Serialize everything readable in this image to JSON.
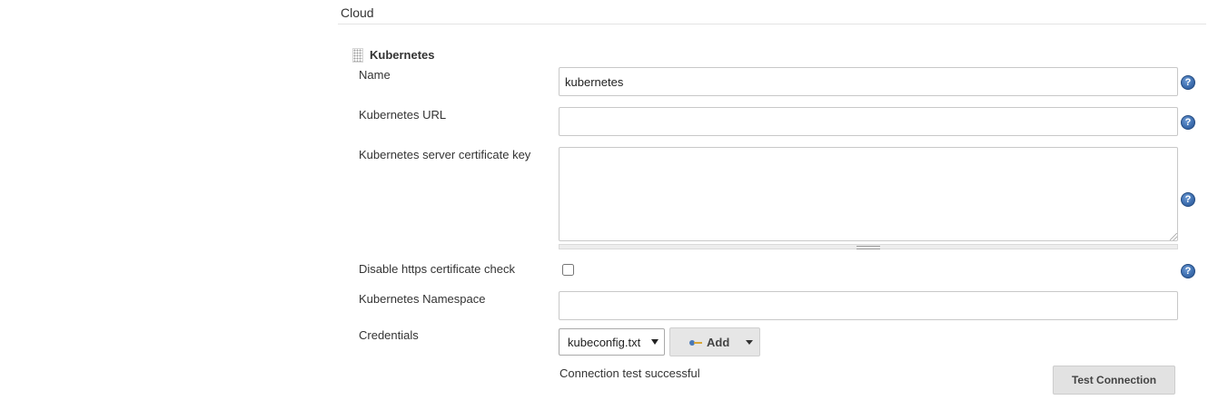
{
  "section": {
    "title": "Cloud"
  },
  "cloud": {
    "name": "Kubernetes"
  },
  "fields": {
    "name": {
      "label": "Name",
      "value": "kubernetes"
    },
    "url": {
      "label": "Kubernetes URL",
      "value": ""
    },
    "cert_key": {
      "label": "Kubernetes server certificate key",
      "value": ""
    },
    "disable_https": {
      "label": "Disable https certificate check",
      "checked": false
    },
    "namespace": {
      "label": "Kubernetes Namespace",
      "value": ""
    },
    "credentials": {
      "label": "Credentials",
      "selected": "kubeconfig.txt"
    }
  },
  "buttons": {
    "add_label": "Add",
    "test_connection_label": "Test Connection"
  },
  "help": {
    "symbol": "?"
  },
  "status": {
    "message": "Connection test successful"
  },
  "icons": {
    "help": "help-icon",
    "key": "key-icon",
    "drag": "drag-handle-icon",
    "dropdown": "chevron-down-icon"
  },
  "colors": {
    "help_icon": "#3e6fb0",
    "button_bg": "#e6e6e6",
    "border": "#c8c8c8"
  }
}
